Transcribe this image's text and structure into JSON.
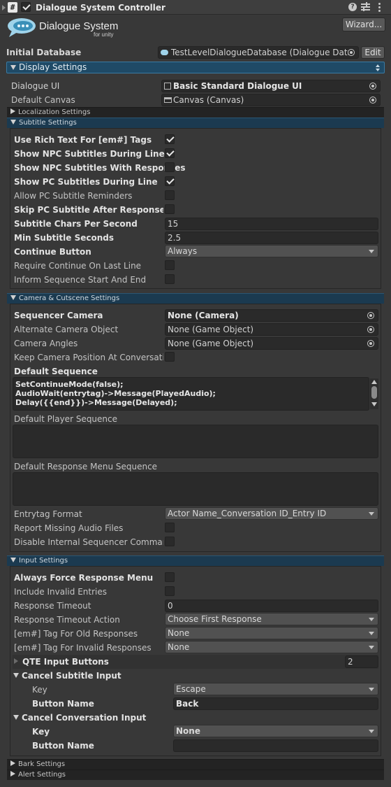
{
  "header": {
    "title": "Dialogue System Controller",
    "logo_main": "Dialogue System",
    "logo_sub": "for unity",
    "wizard_button": "Wizard...",
    "icons": [
      "script-icon",
      "help-icon",
      "preset-icon",
      "more-icon"
    ]
  },
  "initial_database": {
    "label": "Initial Database",
    "value": "TestLevelDialogueDatabase (Dialogue Data",
    "edit_button": "Edit"
  },
  "display_settings": {
    "label": "Display Settings",
    "dialogue_ui": {
      "label": "Dialogue UI",
      "value": "Basic Standard Dialogue UI"
    },
    "default_canvas": {
      "label": "Default Canvas",
      "value": "Canvas (Canvas)"
    },
    "localization_settings": "Localization Settings"
  },
  "subtitle_settings": {
    "label": "Subtitle Settings",
    "rows": [
      {
        "label": "Use Rich Text For [em#] Tags",
        "checked": true
      },
      {
        "label": "Show NPC Subtitles During Line",
        "checked": true
      },
      {
        "label": "Show NPC Subtitles With Responses",
        "checked": false
      },
      {
        "label": "Show PC Subtitles During Line",
        "checked": true
      },
      {
        "label": "Allow PC Subtitle Reminders",
        "checked": false
      },
      {
        "label": "Skip PC Subtitle After Response Menu",
        "checked": false
      }
    ],
    "chars_per_second": {
      "label": "Subtitle Chars Per Second",
      "value": "15"
    },
    "min_seconds": {
      "label": "Min Subtitle Seconds",
      "value": "2.5"
    },
    "continue_button": {
      "label": "Continue Button",
      "value": "Always"
    },
    "require_continue": {
      "label": "Require Continue On Last Line",
      "checked": false
    },
    "inform_sequence": {
      "label": "Inform Sequence Start And End",
      "checked": false
    }
  },
  "camera_settings": {
    "label": "Camera & Cutscene Settings",
    "sequencer_camera": {
      "label": "Sequencer Camera",
      "value": "None (Camera)"
    },
    "alternate_camera": {
      "label": "Alternate Camera Object",
      "value": "None (Game Object)"
    },
    "camera_angles": {
      "label": "Camera Angles",
      "value": "None (Game Object)"
    },
    "keep_camera": {
      "label": "Keep Camera Position At Conversation End",
      "checked": false
    },
    "default_sequence": {
      "label": "Default Sequence",
      "lines": [
        "SetContinueMode(false);",
        "AudioWait(entrytag)->Message(PlayedAudio);",
        "Delay({{end}})->Message(Delayed);"
      ]
    },
    "default_player_sequence": {
      "label": "Default Player Sequence"
    },
    "default_response_menu_sequence": {
      "label": "Default Response Menu Sequence"
    },
    "entrytag_format": {
      "label": "Entrytag Format",
      "value": "Actor Name_Conversation ID_Entry ID"
    },
    "report_missing_audio": {
      "label": "Report Missing Audio Files",
      "checked": false
    },
    "disable_internal_commands": {
      "label": "Disable Internal Sequencer Commands",
      "checked": false
    }
  },
  "input_settings": {
    "label": "Input Settings",
    "always_force_response": {
      "label": "Always Force Response Menu",
      "checked": false
    },
    "include_invalid": {
      "label": "Include Invalid Entries",
      "checked": false
    },
    "response_timeout": {
      "label": "Response Timeout",
      "value": "0"
    },
    "response_timeout_action": {
      "label": "Response Timeout Action",
      "value": "Choose First Response"
    },
    "tag_old_responses": {
      "label": "[em#] Tag For Old Responses",
      "value": "None"
    },
    "tag_invalid_responses": {
      "label": "[em#] Tag For Invalid Responses",
      "value": "None"
    },
    "qte_input_buttons": {
      "label": "QTE Input Buttons",
      "value": "2"
    },
    "cancel_subtitle": {
      "label": "Cancel Subtitle Input",
      "key": {
        "label": "Key",
        "value": "Escape"
      },
      "button_name": {
        "label": "Button Name",
        "value": "Back"
      }
    },
    "cancel_conversation": {
      "label": "Cancel Conversation Input",
      "key": {
        "label": "Key",
        "value": "None"
      },
      "button_name": {
        "label": "Button Name",
        "value": ""
      }
    }
  },
  "bark_settings": "Bark Settings",
  "alert_settings": "Alert Settings"
}
